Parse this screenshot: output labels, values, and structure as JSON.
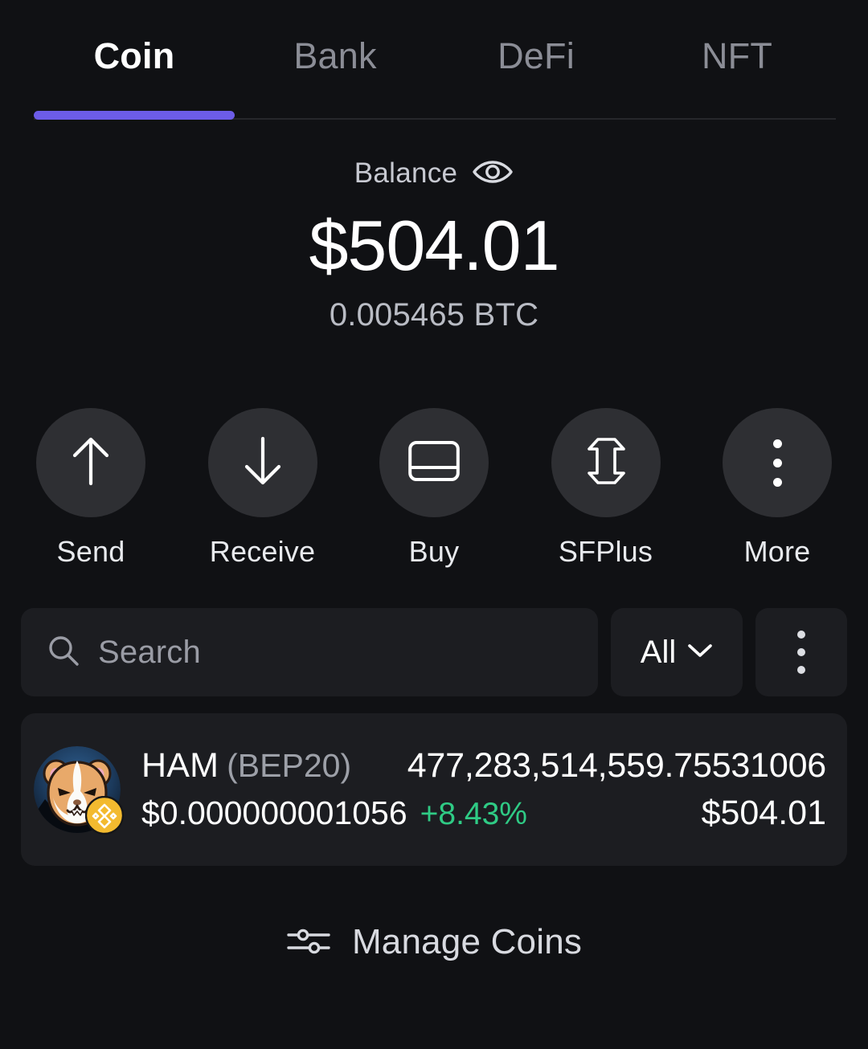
{
  "tabs": [
    {
      "label": "Coin",
      "active": true
    },
    {
      "label": "Bank",
      "active": false
    },
    {
      "label": "DeFi",
      "active": false
    },
    {
      "label": "NFT",
      "active": false
    }
  ],
  "balance": {
    "label": "Balance",
    "visibility_icon": "eye-icon",
    "amount": "$504.01",
    "crypto_equivalent": "0.005465 BTC"
  },
  "actions": [
    {
      "label": "Send",
      "icon": "arrow-up-icon"
    },
    {
      "label": "Receive",
      "icon": "arrow-down-icon"
    },
    {
      "label": "Buy",
      "icon": "credit-card-icon"
    },
    {
      "label": "SFPlus",
      "icon": "sfplus-logo-icon"
    },
    {
      "label": "More",
      "icon": "dots-vertical-icon"
    }
  ],
  "search": {
    "placeholder": "Search",
    "icon": "search-icon",
    "filter_label": "All",
    "filter_icon": "chevron-down-icon",
    "overflow_icon": "dots-vertical-icon"
  },
  "tokens": [
    {
      "symbol": "HAM",
      "network": "(BEP20)",
      "amount": "477,283,514,559.75531006",
      "price": "$0.000000001056",
      "change": "+8.43%",
      "value": "$504.01",
      "avatar": "hamster-avatar",
      "chain_badge": "bnb-chain-badge"
    }
  ],
  "manage_coins": {
    "label": "Manage Coins",
    "icon": "sliders-icon"
  },
  "colors": {
    "background": "#101114",
    "surface": "#1C1D21",
    "accent": "#6C5CE7",
    "positive": "#2FCB85",
    "text_primary": "#FFFFFF",
    "text_secondary": "#9A9CA5",
    "circle_button": "#2E2F33"
  }
}
